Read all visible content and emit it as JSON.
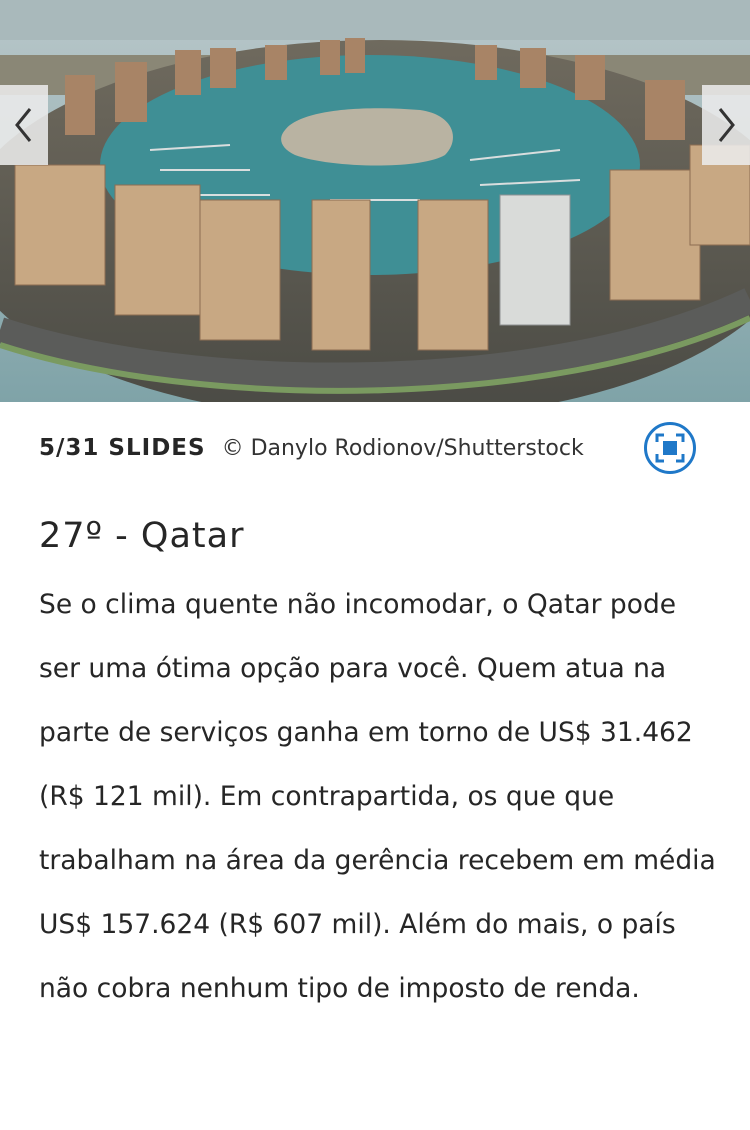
{
  "slide": {
    "counter": "5/31 SLIDES",
    "credit": "© Danylo Rodionov/Shutterstock",
    "title": "27º - Qatar",
    "description": "Se o clima quente não incomodar, o Qatar pode ser uma ótima opção para você. Quem atua na parte de serviços ganha em torno de US$ 31.462 (R$ 121 mil). Em contrapartida, os que que trabalham na área da gerência recebem em média US$ 157.624 (R$ 607 mil). Além do mais, o país não cobra nenhum tipo de imposto de renda.",
    "image_alt": "Vista aérea de marina com prédios em Doha, Qatar"
  },
  "nav": {
    "prev_icon": "chevron-left-icon",
    "next_icon": "chevron-right-icon",
    "fullscreen_icon": "fullscreen-icon"
  },
  "colors": {
    "accent": "#1f78c8",
    "text": "#262626",
    "water": "#3f8f95"
  }
}
